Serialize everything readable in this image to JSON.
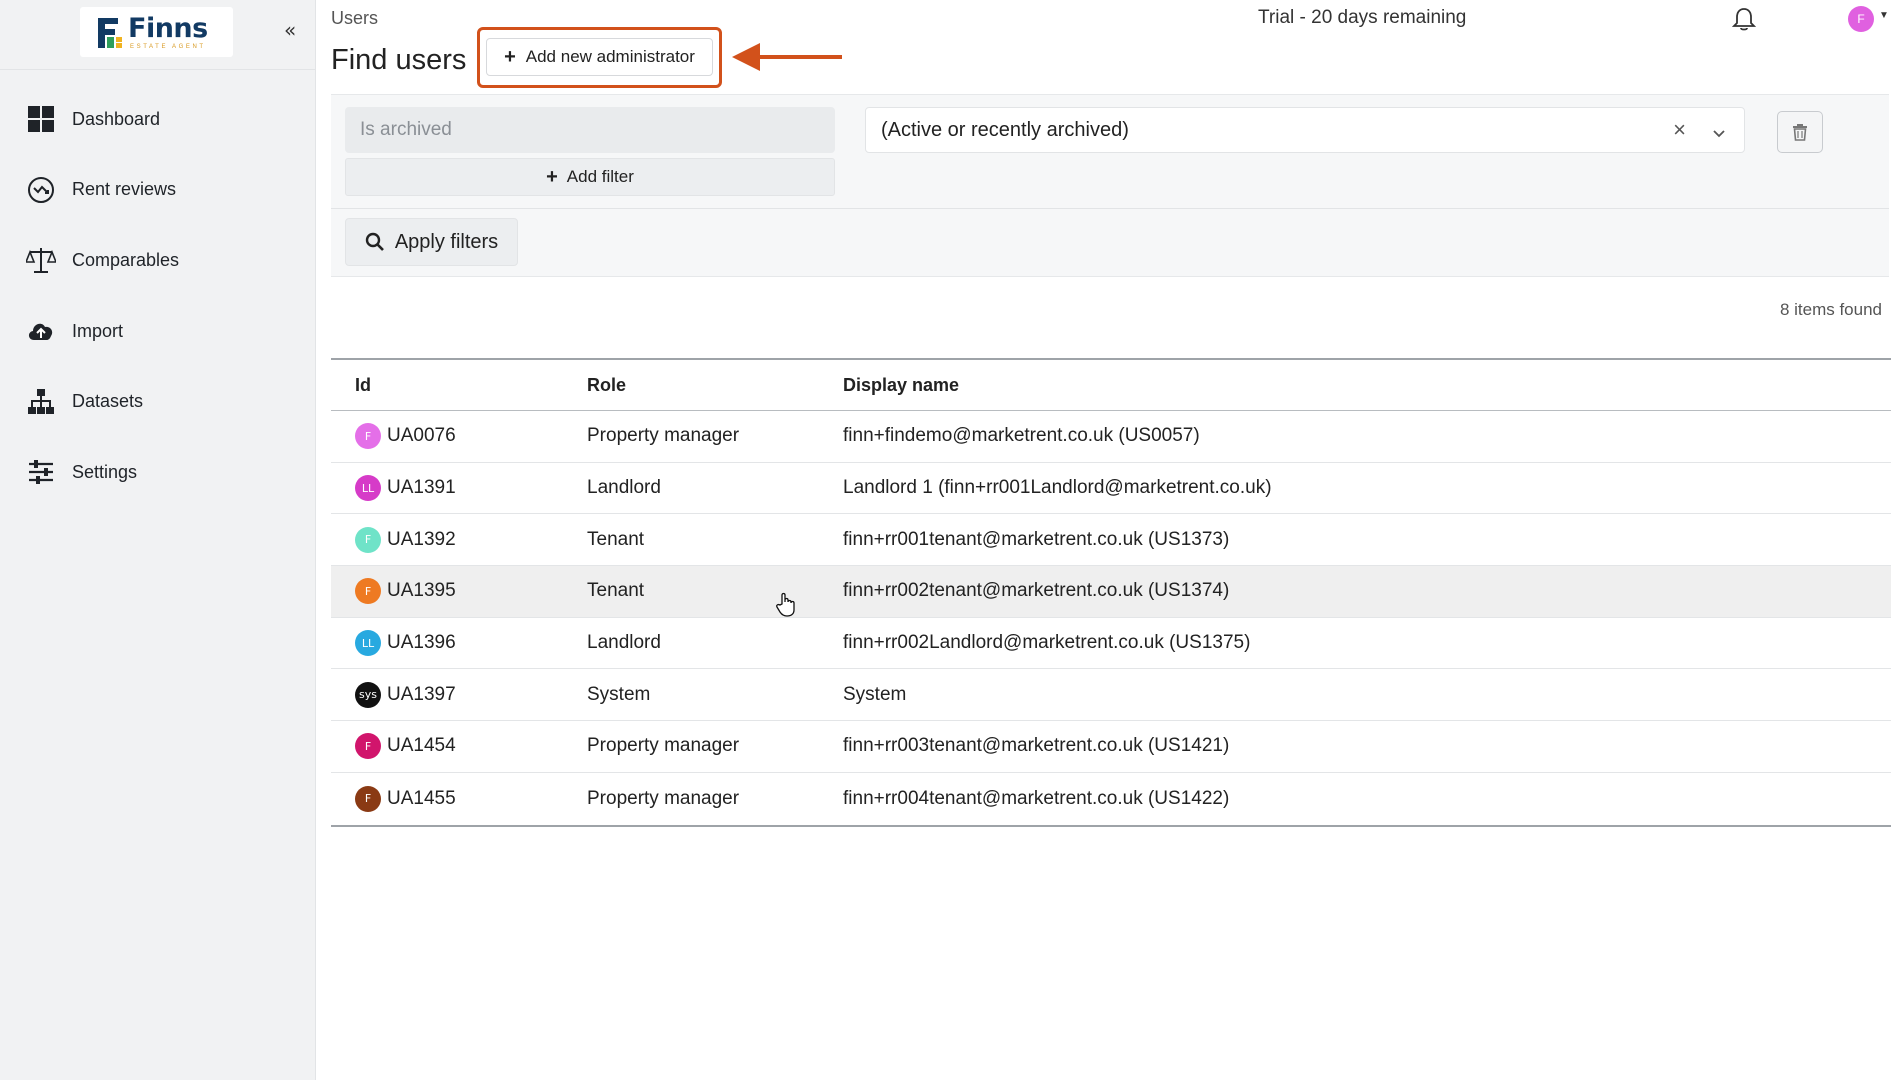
{
  "sidebar": {
    "logo": {
      "name": "Finns",
      "tagline": "ESTATE AGENT"
    },
    "collapse_glyph": "«",
    "items": [
      {
        "label": "Dashboard",
        "icon": "dashboard-icon"
      },
      {
        "label": "Rent reviews",
        "icon": "rent-reviews-icon"
      },
      {
        "label": "Comparables",
        "icon": "scales-icon"
      },
      {
        "label": "Import",
        "icon": "cloud-upload-icon"
      },
      {
        "label": "Datasets",
        "icon": "hierarchy-icon"
      },
      {
        "label": "Settings",
        "icon": "sliders-icon"
      }
    ]
  },
  "header": {
    "breadcrumb": "Users",
    "trial_text": "Trial - 20 days remaining",
    "user_initial": "F",
    "page_title": "Find users",
    "add_admin_label": "Add new administrator",
    "highlight_color": "#d2511b"
  },
  "filters": {
    "field_placeholder": "Is archived",
    "add_filter_label": "Add filter",
    "selected_value": "(Active or recently archived)",
    "clear_glyph": "×",
    "apply_label": "Apply filters"
  },
  "results": {
    "count_text": "8 items found"
  },
  "table": {
    "columns": [
      "Id",
      "Role",
      "Display name"
    ],
    "rows": [
      {
        "initials": "F",
        "avatar_color": "#e46fe8",
        "id": "UA0076",
        "role": "Property manager",
        "display_name": "finn+findemo@marketrent.co.uk (US0057)"
      },
      {
        "initials": "LL",
        "avatar_color": "#d63bc8",
        "id": "UA1391",
        "role": "Landlord",
        "display_name": "Landlord 1 (finn+rr001Landlord@marketrent.co.uk)"
      },
      {
        "initials": "F",
        "avatar_color": "#6fe3c8",
        "id": "UA1392",
        "role": "Tenant",
        "display_name": "finn+rr001tenant@marketrent.co.uk (US1373)"
      },
      {
        "initials": "F",
        "avatar_color": "#ee7a22",
        "id": "UA1395",
        "role": "Tenant",
        "display_name": "finn+rr002tenant@marketrent.co.uk (US1374)"
      },
      {
        "initials": "LL",
        "avatar_color": "#28a9e0",
        "id": "UA1396",
        "role": "Landlord",
        "display_name": "finn+rr002Landlord@marketrent.co.uk (US1375)"
      },
      {
        "initials": "sys",
        "avatar_color": "#111111",
        "id": "UA1397",
        "role": "System",
        "display_name": "System"
      },
      {
        "initials": "F",
        "avatar_color": "#d1156c",
        "id": "UA1454",
        "role": "Property manager",
        "display_name": "finn+rr003tenant@marketrent.co.uk (US1421)"
      },
      {
        "initials": "F",
        "avatar_color": "#8a3a14",
        "id": "UA1455",
        "role": "Property manager",
        "display_name": "finn+rr004tenant@marketrent.co.uk (US1422)"
      }
    ]
  }
}
